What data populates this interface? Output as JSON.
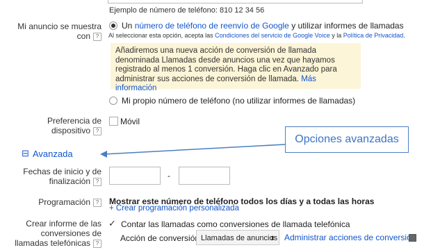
{
  "phone_example": "Ejemplo de número de teléfono: 810 12 34 56",
  "ad_shows": {
    "label_line1": "Mi anuncio se muestra",
    "label_line2": "con",
    "option1_prefix": "Un ",
    "option1_link": "número de teléfono de reenvío de Google",
    "option1_suffix": " y utilizar informes de llamadas",
    "terms_prefix": "Al seleccionar esta opción, acepta las ",
    "terms_link1": "Condiciones del servicio de Google Voice",
    "terms_mid": " y la ",
    "terms_link2": "Política de Privacidad",
    "terms_end": ".",
    "callout_text": "Añadiremos una nueva acción de conversión de llamada denominada Llamadas desde anuncios una vez que hayamos registrado al menos 1 conversión. Haga clic en Avanzado para administrar sus acciones de conversión de llamada.",
    "callout_link": "Más información",
    "option2": "Mi propio número de teléfono (no utilizar informes de llamadas)"
  },
  "device": {
    "label_line1": "Preferencia de",
    "label_line2": "dispositivo",
    "mobile": "Móvil"
  },
  "advanced": {
    "toggle": "⊟",
    "title": "Avanzada"
  },
  "annotation": "Opciones avanzadas",
  "dates": {
    "label_line1": "Fechas de inicio y de",
    "label_line2": "finalización",
    "dash": "-"
  },
  "schedule": {
    "label": "Programación",
    "text": "Mostrar este número de teléfono todos los días y a todas las horas",
    "link": "+ Crear programación personalizada"
  },
  "conversions": {
    "label_line1": "Crear informe de las",
    "label_line2": "conversiones de",
    "label_line3": "llamadas telefónicas",
    "checkbox_text": "Contar las llamadas como conversiones de llamada telefónica",
    "action_label": "Acción de conversión",
    "select_value": "Llamadas de anuncios",
    "manage_link": "Administrar acciones de conversión"
  },
  "help_glyph": "?",
  "check_glyph": "✓",
  "colors": {
    "link": "#1155cc",
    "callout_bg": "#fdf5d8",
    "annotation": "#3b74c3"
  }
}
